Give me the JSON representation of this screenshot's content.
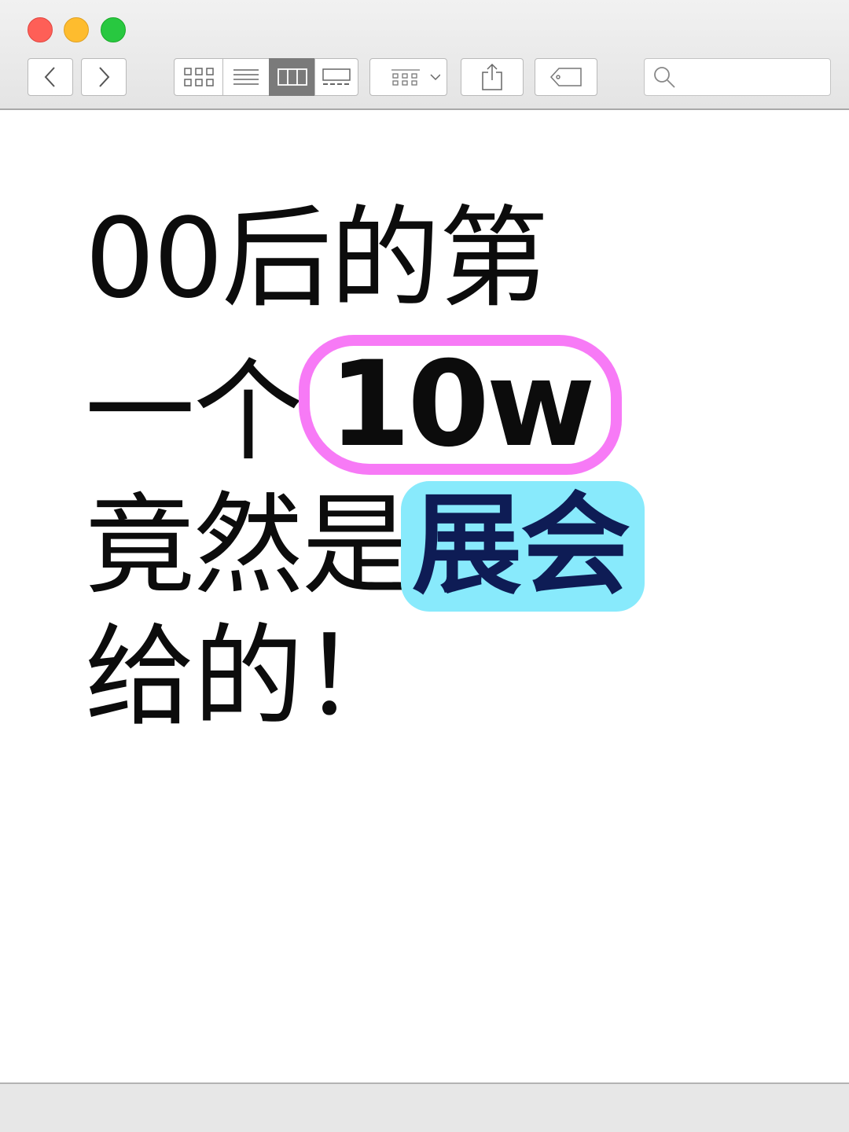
{
  "window": {
    "controls": [
      "close",
      "minimize",
      "zoom"
    ],
    "colors": {
      "close": "#fe5f57",
      "minimize": "#febc2e",
      "zoom": "#28c840"
    }
  },
  "toolbar": {
    "icons": [
      "chevron-left-icon",
      "chevron-right-icon",
      "icon-view-icon",
      "list-view-icon",
      "column-view-icon",
      "gallery-view-icon",
      "group-by-icon",
      "share-icon",
      "tag-icon",
      "search-icon"
    ],
    "selected_view": "column-view",
    "search": {
      "value": "",
      "placeholder": ""
    }
  },
  "content": {
    "line1": "00后的第",
    "line2_prefix": "一个",
    "line2_circled": "10w",
    "line3_prefix": "竟然是",
    "line3_highlight": "展会",
    "line4": "给的！",
    "colors": {
      "circle": "#f77af6",
      "highlight_bg": "#88eafc",
      "highlight_text": "#0e1c55",
      "text": "#0c0c0c"
    }
  }
}
